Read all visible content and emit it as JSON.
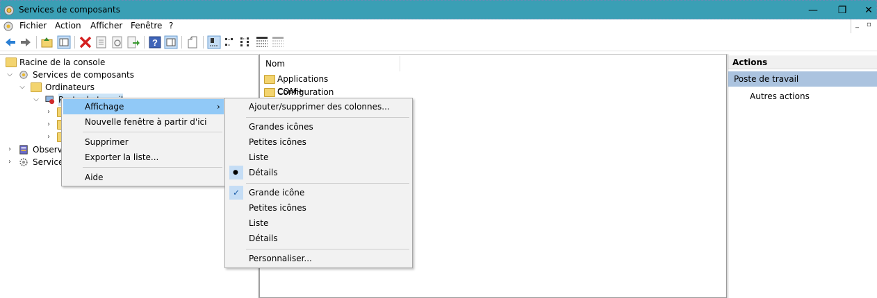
{
  "window": {
    "title": "Services de composants"
  },
  "menubar": {
    "items": [
      "Fichier",
      "Action",
      "Afficher",
      "Fenêtre",
      "?"
    ]
  },
  "tree": {
    "items": [
      {
        "label": "Racine de la console"
      },
      {
        "label": "Services de composants"
      },
      {
        "label": "Ordinateurs"
      },
      {
        "label": "Poste de travail"
      },
      {
        "label": "Observa"
      },
      {
        "label": "Services"
      }
    ]
  },
  "list": {
    "column": "Nom",
    "rows": [
      "Applications COM+",
      "Configuration DCOM"
    ]
  },
  "actions": {
    "title": "Actions",
    "section": "Poste de travail",
    "item": "Autres actions"
  },
  "context_menu": {
    "items": [
      "Affichage",
      "Nouvelle fenêtre à partir d'ici",
      "Supprimer",
      "Exporter la liste...",
      "Aide"
    ],
    "submenu_arrow": "›"
  },
  "submenu": {
    "items": [
      "Ajouter/supprimer des colonnes...",
      "Grandes icônes",
      "Petites icônes",
      "Liste",
      "Détails",
      "Grande icône",
      "Petites icônes",
      "Liste",
      "Détails",
      "Personnaliser..."
    ],
    "selected_bullet": "●",
    "check_mark": "✓"
  },
  "colors": {
    "titlebar": "#3a9fb5",
    "highlight": "#91c9f7",
    "actions_section": "#abc3df"
  }
}
